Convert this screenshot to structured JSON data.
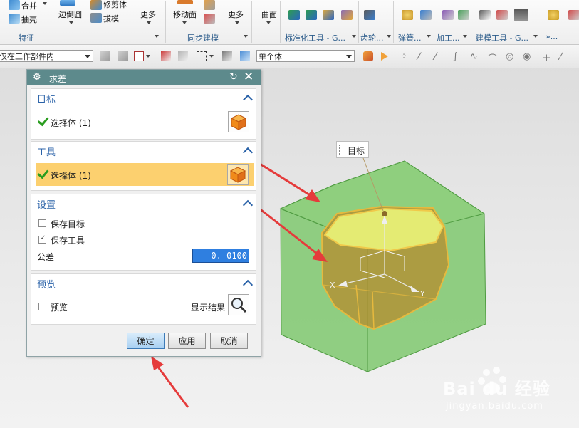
{
  "ribbon": {
    "feature_group": {
      "items": [
        "合并",
        "抽壳"
      ],
      "label": "特征"
    },
    "edge_blend": "边倒圆",
    "trim_body": "修剪体",
    "draft": "拔模",
    "more1": "更多",
    "move_face": "移动面",
    "sync_group_label": "同步建模",
    "more2": "更多",
    "surface": "曲面",
    "std_tools_label": "标准化工具 - G...",
    "gear_label": "齿轮...",
    "spring_label": "弹簧...",
    "machining_label": "加工...",
    "modeling_tools_label": "建模工具 - G...",
    "dot_label": "»..."
  },
  "toolbar2": {
    "scope_filter": "仅在工作部件内",
    "body_filter": "单个体"
  },
  "dialog": {
    "title": "求差",
    "target": {
      "header": "目标",
      "select_label": "选择体 (1)"
    },
    "tool": {
      "header": "工具",
      "select_label": "选择体 (1)"
    },
    "settings": {
      "header": "设置",
      "keep_target": {
        "label": "保存目标",
        "checked": false
      },
      "keep_tool": {
        "label": "保存工具",
        "checked": true
      },
      "tolerance_label": "公差",
      "tolerance_value": "0. 0100"
    },
    "preview": {
      "header": "预览",
      "preview_label": "预览",
      "show_result_label": "显示结果"
    },
    "buttons": {
      "ok": "确定",
      "apply": "应用",
      "cancel": "取消"
    }
  },
  "viewport": {
    "target_label": "目标",
    "axis_x": "X",
    "axis_y": "Y",
    "watermark_brand": "Bai du 经验",
    "watermark_url": "jingyan.baidu.com"
  },
  "colors": {
    "dialog_title_bg": "#5d8a8c",
    "section_header": "#2a62a8",
    "highlight_row": "#fcd06f",
    "tolerance_field": "#2f7fe0",
    "target_body": "#6fbf5e",
    "tool_body": "#d9c03a",
    "arrow": "#e53b3b"
  }
}
